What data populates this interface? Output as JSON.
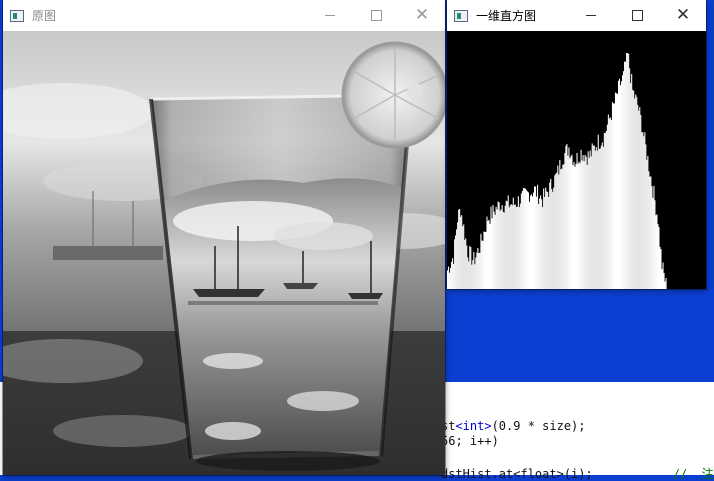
{
  "source_window": {
    "title": "原图",
    "controls": {
      "minimize": "minimize",
      "maximize": "maximize",
      "close": "close"
    }
  },
  "histogram_window": {
    "title": "一维直方图",
    "controls": {
      "minimize": "minimize",
      "maximize": "maximize",
      "close": "close"
    }
  },
  "code_editor": {
    "lines": [
      {
        "parts": [
          "st",
          "<int>",
          "(0.9 * size);"
        ]
      },
      {
        "parts": [
          "56; i++)"
        ]
      },
      {
        "parts": [
          "dstHist.at<float>(i);",
          "//  注"
        ]
      }
    ]
  },
  "chart_data": {
    "type": "area",
    "title": "",
    "xlabel": "",
    "ylabel": "",
    "x_range": [
      0,
      255
    ],
    "y_range": [
      0,
      1
    ],
    "description_points": [
      [
        0,
        0.08
      ],
      [
        6,
        0.14
      ],
      [
        10,
        0.3
      ],
      [
        13,
        0.34
      ],
      [
        16,
        0.26
      ],
      [
        20,
        0.16
      ],
      [
        26,
        0.12
      ],
      [
        32,
        0.18
      ],
      [
        40,
        0.3
      ],
      [
        52,
        0.36
      ],
      [
        66,
        0.36
      ],
      [
        78,
        0.4
      ],
      [
        86,
        0.42
      ],
      [
        94,
        0.38
      ],
      [
        100,
        0.42
      ],
      [
        108,
        0.48
      ],
      [
        114,
        0.56
      ],
      [
        120,
        0.6
      ],
      [
        126,
        0.54
      ],
      [
        132,
        0.58
      ],
      [
        140,
        0.56
      ],
      [
        148,
        0.62
      ],
      [
        154,
        0.64
      ],
      [
        160,
        0.72
      ],
      [
        166,
        0.8
      ],
      [
        170,
        0.86
      ],
      [
        174,
        0.9
      ],
      [
        176,
        0.96
      ],
      [
        178,
        1.0
      ],
      [
        180,
        0.94
      ],
      [
        183,
        0.84
      ],
      [
        188,
        0.78
      ],
      [
        192,
        0.7
      ],
      [
        196,
        0.6
      ],
      [
        200,
        0.5
      ],
      [
        204,
        0.4
      ],
      [
        208,
        0.3
      ],
      [
        212,
        0.1
      ],
      [
        216,
        0.02
      ],
      [
        220,
        0.0
      ],
      [
        255,
        0.0
      ]
    ],
    "colors": {
      "background": "#000000",
      "fill": "#ffffff"
    }
  }
}
